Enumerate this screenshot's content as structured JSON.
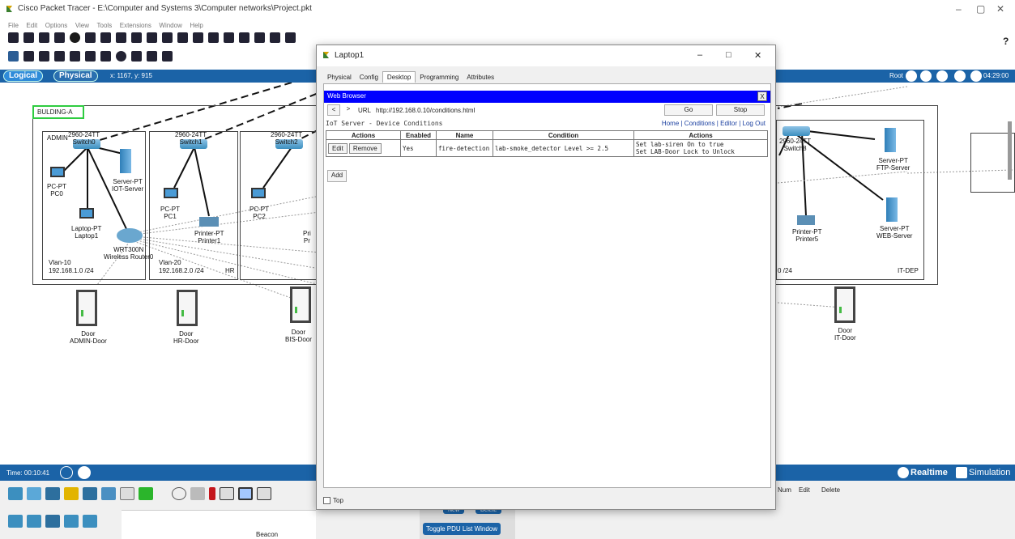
{
  "app": {
    "title": "Cisco Packet Tracer - E:\\Computer and Systems 3\\Computer networks\\Project.pkt",
    "menu": [
      "File",
      "Edit",
      "Options",
      "View",
      "Tools",
      "Extensions",
      "Window",
      "Help"
    ],
    "help_glyph": "?"
  },
  "navbar": {
    "logical": "Logical",
    "physical": "Physical",
    "coords": "x: 1167, y: 915",
    "root": "Root",
    "clock": "04:29:00"
  },
  "workspace": {
    "building": "BULDING-A",
    "areas": {
      "admin": "ADMIN",
      "admin_vlan": "Vlan-10",
      "admin_net": "192.168.1.0 /24",
      "hr_vlan": "Vlan-20",
      "hr_net": "192.168.2.0 /24",
      "hr_name": "HR",
      "it_net": "0 /24",
      "it_name": "IT-DEP"
    },
    "devices": {
      "switch0": "2960-24TT\nSwitch0",
      "server_iot": "Server-PT\nIOT-Server",
      "pc0": "PC-PT\nPC0",
      "laptop1": "Laptop-PT\nLaptop1",
      "router": "WRT300N\nWireless Router0",
      "switch1": "2960-24TT\nSwitch1",
      "pc1": "PC-PT\nPC1",
      "printer": "Printer-PT\nPrinter1",
      "switch2": "2960-24TT\nSwitch2",
      "pc2": "PC-PT\nPC2",
      "pri_partial": "Pri\nPr",
      "switch8": "2960-24TT\nSwitch8",
      "ftp": "Server-PT\nFTP-Server",
      "web": "Server-PT\nWEB-Server",
      "printer5": "Printer-PT\nPrinter5"
    },
    "doors": {
      "admin": "Door\nADMIN-Door",
      "hr": "Door\nHR-Door",
      "bis": "Door\nBIS-Door",
      "it": "Door\nIT-Door"
    }
  },
  "status": {
    "time": "Time: 00:10:41",
    "realtime": "Realtime",
    "simulation": "Simulation"
  },
  "bottom": {
    "beacon": "Beacon",
    "new": "New",
    "delete": "Delete",
    "toggle_pdu": "Toggle PDU List Window",
    "cols": [
      "Num",
      "Edit",
      "Delete"
    ]
  },
  "modal": {
    "title": "Laptop1",
    "tabs": [
      "Physical",
      "Config",
      "Desktop",
      "Programming",
      "Attributes"
    ],
    "browser_title": "Web Browser",
    "close_x": "X",
    "url_label": "URL",
    "url": "http://192.168.0.10/conditions.html",
    "go": "Go",
    "stop": "Stop",
    "back": "<",
    "forward": ">",
    "page_title": "IoT Server - Device Conditions",
    "nav_links": "Home | Conditions | Editor | Log Out",
    "table_headers": [
      "Actions",
      "Enabled",
      "Name",
      "Condition",
      "Actions"
    ],
    "row": {
      "edit": "Edit",
      "remove": "Remove",
      "enabled": "Yes",
      "name": "fire-detection",
      "condition": "lab-smoke_detector Level >= 2.5",
      "action1": "Set lab-siren On to true",
      "action2": "Set LAB-Door Lock to Unlock"
    },
    "add": "Add",
    "top_checkbox": "Top",
    "window_controls": [
      "–",
      "□",
      "✕"
    ]
  },
  "colors": {
    "nav_blue": "#1b63a7",
    "browser_bar": "#0000ff",
    "building_label_border": "#2ecc40"
  }
}
